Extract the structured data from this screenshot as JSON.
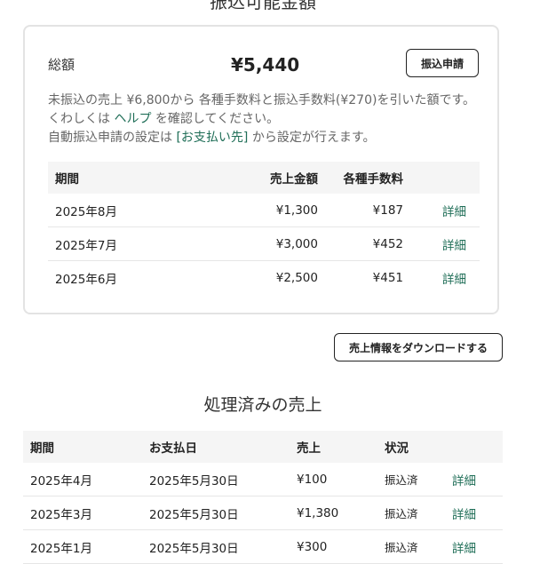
{
  "top_title": "振込可能金額",
  "summary": {
    "total_label": "総額",
    "total_amount": "¥5,440",
    "apply_button": "振込申請",
    "desc_line1_pre": "未振込の売上 ¥6,800から 各種手数料と振込手数料(¥270)を引いた額です。くわしくは ",
    "help_link": "ヘルプ",
    "desc_line1_post": " を確認してください。",
    "desc_line2_pre": "自動振込申請の設定は ",
    "payee_link": "[お支払い先]",
    "desc_line2_post": " から設定が行えます。"
  },
  "pending_table": {
    "headers": {
      "period": "期間",
      "sales": "売上金額",
      "fees": "各種手数料"
    },
    "rows": [
      {
        "period": "2025年8月",
        "sales": "¥1,300",
        "fees": "¥187",
        "detail": "詳細"
      },
      {
        "period": "2025年7月",
        "sales": "¥3,000",
        "fees": "¥452",
        "detail": "詳細"
      },
      {
        "period": "2025年6月",
        "sales": "¥2,500",
        "fees": "¥451",
        "detail": "詳細"
      }
    ]
  },
  "download_button": "売上情報をダウンロードする",
  "processed": {
    "title": "処理済みの売上",
    "headers": {
      "period": "期間",
      "pay_date": "お支払日",
      "sales": "売上",
      "status": "状況"
    },
    "rows": [
      {
        "period": "2025年4月",
        "pay_date": "2025年5月30日",
        "sales": "¥100",
        "status": "振込済",
        "detail": "詳細"
      },
      {
        "period": "2025年3月",
        "pay_date": "2025年5月30日",
        "sales": "¥1,380",
        "status": "振込済",
        "detail": "詳細"
      },
      {
        "period": "2025年1月",
        "pay_date": "2025年5月30日",
        "sales": "¥300",
        "status": "振込済",
        "detail": "詳細"
      }
    ]
  }
}
